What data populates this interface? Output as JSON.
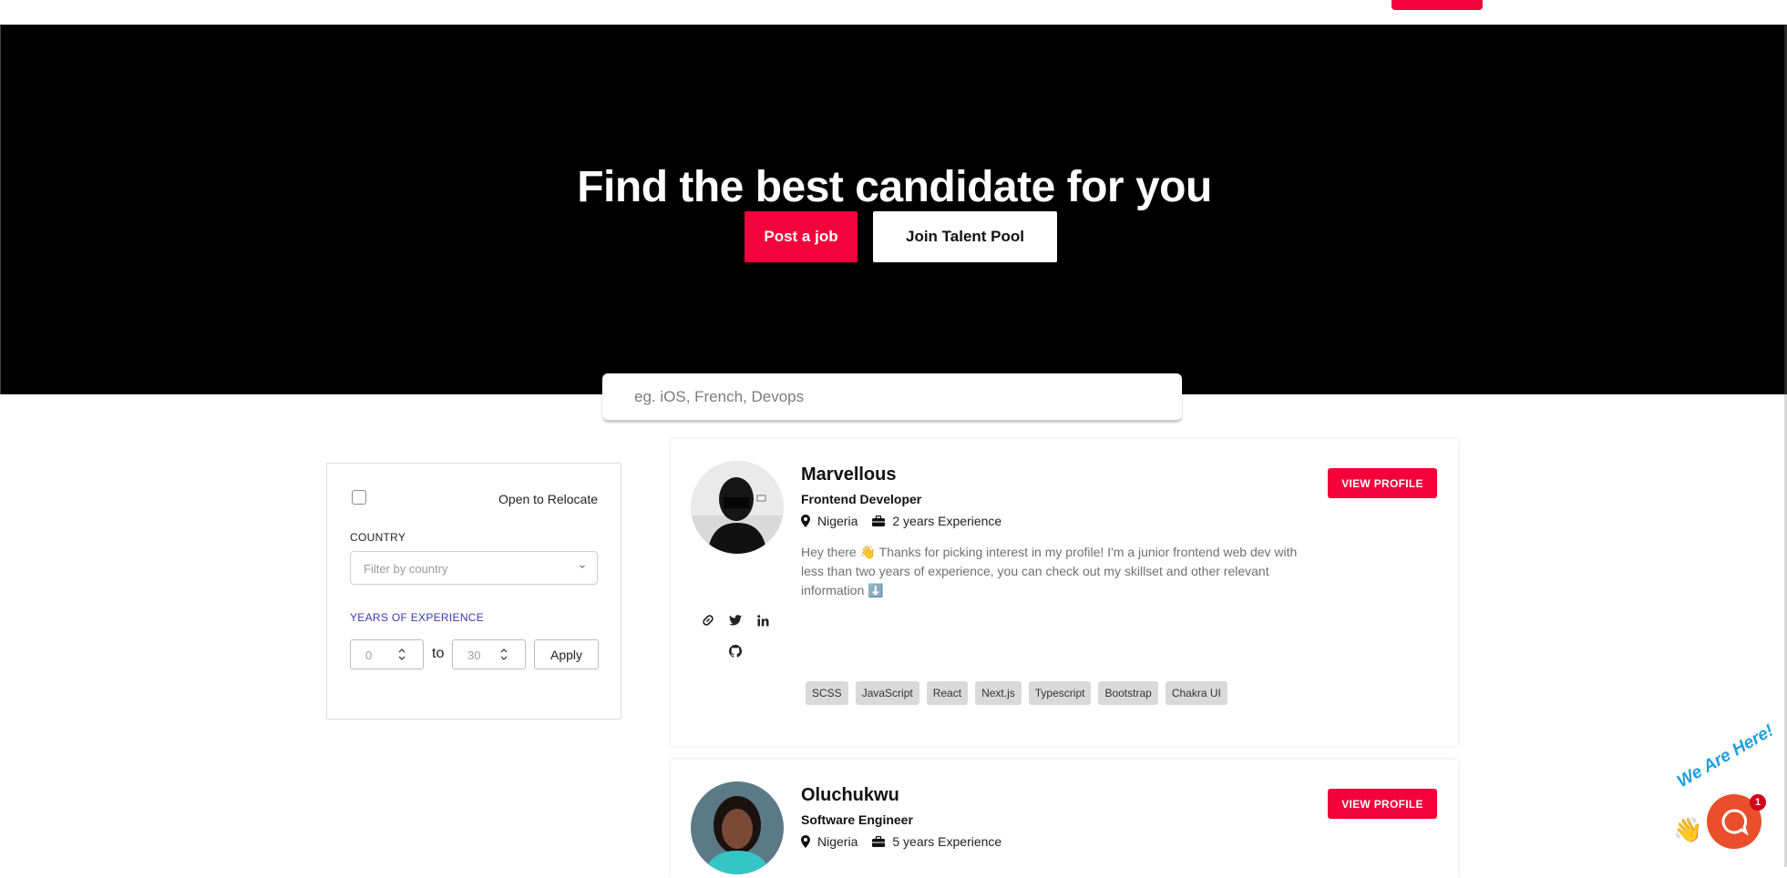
{
  "hero": {
    "title": "Find the best candidate for you",
    "post_job_label": "Post a job",
    "join_pool_label": "Join Talent Pool"
  },
  "search": {
    "placeholder": "eg. iOS, French, Devops"
  },
  "filters": {
    "relocate_label": "Open to Relocate",
    "relocate_checked": false,
    "country_label": "COUNTRY",
    "country_placeholder": "Filter by country",
    "years_label": "YEARS OF EXPERIENCE",
    "years_min": "0",
    "years_to": "to",
    "years_max": "30",
    "apply_label": "Apply"
  },
  "candidates": [
    {
      "name": "Marvellous",
      "role": "Frontend Developer",
      "country": "Nigeria",
      "experience": "2 years Experience",
      "bio": "Hey there 👋 Thanks for picking interest in my profile! I'm a junior frontend web dev with less than two years of experience, you can check out my skillset and other relevant information ⬇️",
      "view_label": "VIEW PROFILE",
      "socials": [
        "link-icon",
        "twitter-icon",
        "linkedin-icon",
        "github-icon"
      ],
      "skills": [
        "SCSS",
        "JavaScript",
        "React",
        "Next.js",
        "Typescript",
        "Bootstrap",
        "Chakra UI"
      ]
    },
    {
      "name": "Oluchukwu",
      "role": "Software Engineer",
      "country": "Nigeria",
      "experience": "5 years Experience",
      "view_label": "VIEW PROFILE"
    }
  ],
  "chat": {
    "tagline": "We Are Here!",
    "badge_count": "1"
  },
  "colors": {
    "accent": "#f4003a",
    "hero_bg": "#000000",
    "chat": "#ea4f2b"
  }
}
